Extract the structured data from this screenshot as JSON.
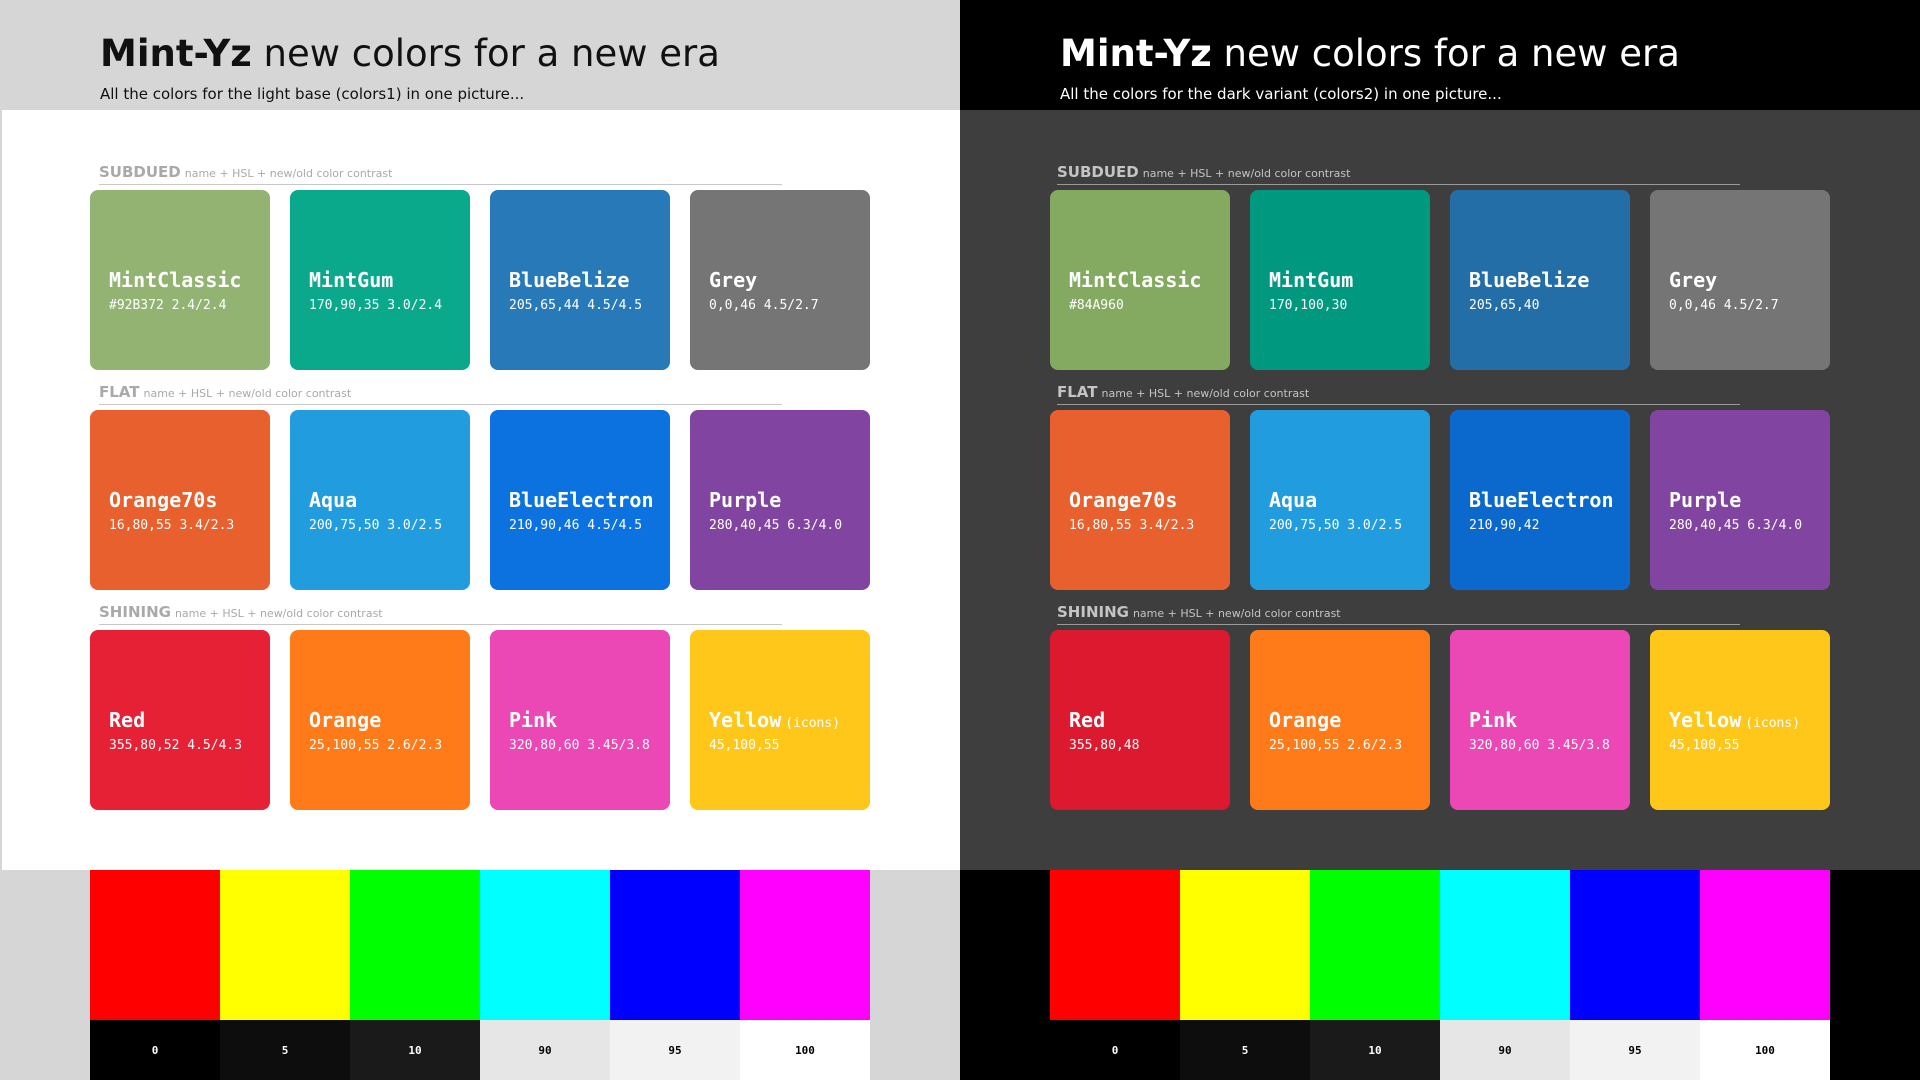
{
  "panels": [
    {
      "title_brand": "Mint-Yz",
      "title_rest": "new colors for a new era",
      "subtitle": "All the colors for the light base (colors1) in one picture...",
      "sections": [
        {
          "name": "SUBDUED",
          "desc": "name + HSL + new/old color contrast",
          "swatches": [
            {
              "name": "MintClassic",
              "values": "#92B372 2.4/2.4",
              "color": "#92B372"
            },
            {
              "name": "MintGum",
              "values": "170,90,35 3.0/2.4",
              "color": "#0AA98C"
            },
            {
              "name": "BlueBelize",
              "values": "205,65,44 4.5/4.5",
              "color": "#2879B8"
            },
            {
              "name": "Grey",
              "values": "0,0,46 4.5/2.7",
              "color": "#757575"
            }
          ]
        },
        {
          "name": "FLAT",
          "desc": "name + HSL + new/old color contrast",
          "swatches": [
            {
              "name": "Orange70s",
              "values": "16,80,55 3.4/2.3",
              "color": "#E9602F"
            },
            {
              "name": "Aqua",
              "values": "200,75,50 3.0/2.5",
              "color": "#209CDF"
            },
            {
              "name": "BlueElectron",
              "values": "210,90,46 4.5/4.5",
              "color": "#0C72DF"
            },
            {
              "name": "Purple",
              "values": "280,40,45 6.3/4.0",
              "color": "#8145A1"
            }
          ]
        },
        {
          "name": "SHINING",
          "desc": "name + HSL + new/old color contrast",
          "swatches": [
            {
              "name": "Red",
              "values": "355,80,52 4.5/4.3",
              "color": "#E62035"
            },
            {
              "name": "Orange",
              "values": "25,100,55 2.6/2.3",
              "color": "#FF7B1A"
            },
            {
              "name": "Pink",
              "values": "320,80,60 3.45/3.8",
              "color": "#EB47B5"
            },
            {
              "name": "Yellow",
              "note": "(icons)",
              "values": "45,100,55",
              "color": "#FFC71A"
            }
          ]
        }
      ]
    },
    {
      "title_brand": "Mint-Yz",
      "title_rest": "new colors for a new era",
      "subtitle": "All the colors for the dark variant (colors2) in one picture...",
      "sections": [
        {
          "name": "SUBDUED",
          "desc": "name + HSL + new/old color contrast",
          "swatches": [
            {
              "name": "MintClassic",
              "values": "#84A960",
              "color": "#84A960"
            },
            {
              "name": "MintGum",
              "values": "170,100,30",
              "color": "#009980"
            },
            {
              "name": "BlueBelize",
              "values": "205,65,40",
              "color": "#246EA8"
            },
            {
              "name": "Grey",
              "values": "0,0,46 4.5/2.7",
              "color": "#757575"
            }
          ]
        },
        {
          "name": "FLAT",
          "desc": "name + HSL + new/old color contrast",
          "swatches": [
            {
              "name": "Orange70s",
              "values": "16,80,55 3.4/2.3",
              "color": "#E9602F"
            },
            {
              "name": "Aqua",
              "values": "200,75,50 3.0/2.5",
              "color": "#209CDF"
            },
            {
              "name": "BlueElectron",
              "values": "210,90,42",
              "color": "#0B68CC"
            },
            {
              "name": "Purple",
              "values": "280,40,45 6.3/4.0",
              "color": "#8145A1"
            }
          ]
        },
        {
          "name": "SHINING",
          "desc": "name + HSL + new/old color contrast",
          "swatches": [
            {
              "name": "Red",
              "values": "355,80,48",
              "color": "#DD1930"
            },
            {
              "name": "Orange",
              "values": "25,100,55 2.6/2.3",
              "color": "#FF7B1A"
            },
            {
              "name": "Pink",
              "values": "320,80,60 3.45/3.8",
              "color": "#EB47B5"
            },
            {
              "name": "Yellow",
              "note": "(icons)",
              "values": "45,100,55",
              "color": "#FFC71A"
            }
          ]
        }
      ]
    }
  ],
  "color_bars": [
    "#FF0000",
    "#FFFF00",
    "#00FF00",
    "#00FFFF",
    "#0000FF",
    "#FF00FF"
  ],
  "grey_steps": [
    {
      "label": "0",
      "bg": "#000000",
      "fg": "#FFFFFF"
    },
    {
      "label": "5",
      "bg": "#0D0D0D",
      "fg": "#FFFFFF"
    },
    {
      "label": "10",
      "bg": "#1A1A1A",
      "fg": "#FFFFFF"
    },
    {
      "label": "90",
      "bg": "#E6E6E6",
      "fg": "#000000"
    },
    {
      "label": "95",
      "bg": "#F2F2F2",
      "fg": "#000000"
    },
    {
      "label": "100",
      "bg": "#FFFFFF",
      "fg": "#000000"
    }
  ]
}
